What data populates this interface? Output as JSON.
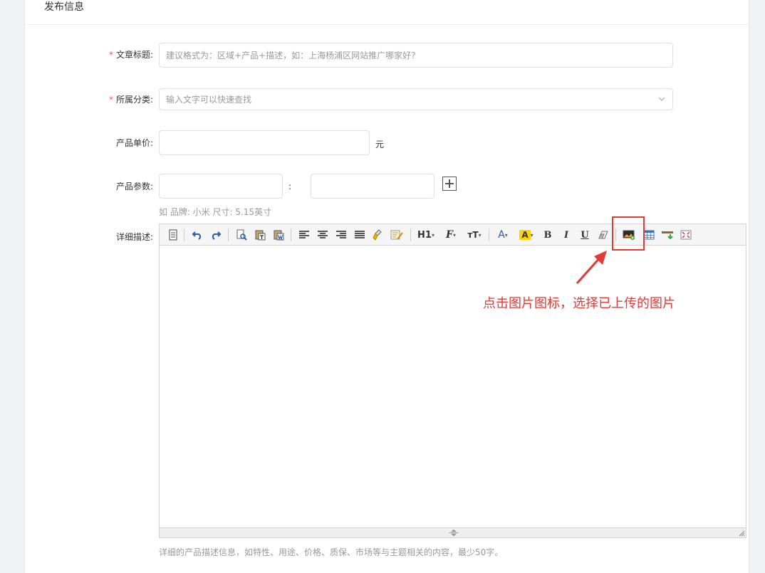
{
  "panel": {
    "title": "发布信息"
  },
  "form": {
    "title": {
      "required_mark": "*",
      "label": "文章标题:",
      "placeholder": "建议格式为：区域+产品+描述，如：上海杨浦区网站推广哪家好?"
    },
    "category": {
      "required_mark": "*",
      "label": "所属分类:",
      "placeholder": "输入文字可以快速查找"
    },
    "price": {
      "label": "产品单价:",
      "unit": "元"
    },
    "params": {
      "label": "产品参数:",
      "separator": ":",
      "hint": "如 品牌: 小米 尺寸: 5.15英寸"
    },
    "description": {
      "label": "详细描述:",
      "hint": "详细的产品描述信息，如特性、用途、价格、质保、市场等与主题相关的内容，最少50字。"
    }
  },
  "toolbar": {
    "h1_label": "H1",
    "font_label": "F",
    "size_label": "тT",
    "font_color_label": "A",
    "highlight_label": "A",
    "bold_label": "B",
    "italic_label": "I",
    "underline_label": "U"
  },
  "annotation": {
    "text": "点击图片图标，选择已上传的图片",
    "color": "#e53935"
  },
  "colors": {
    "required": "#ff4d4f",
    "border": "#dcdfe6",
    "placeholder": "#999999"
  }
}
